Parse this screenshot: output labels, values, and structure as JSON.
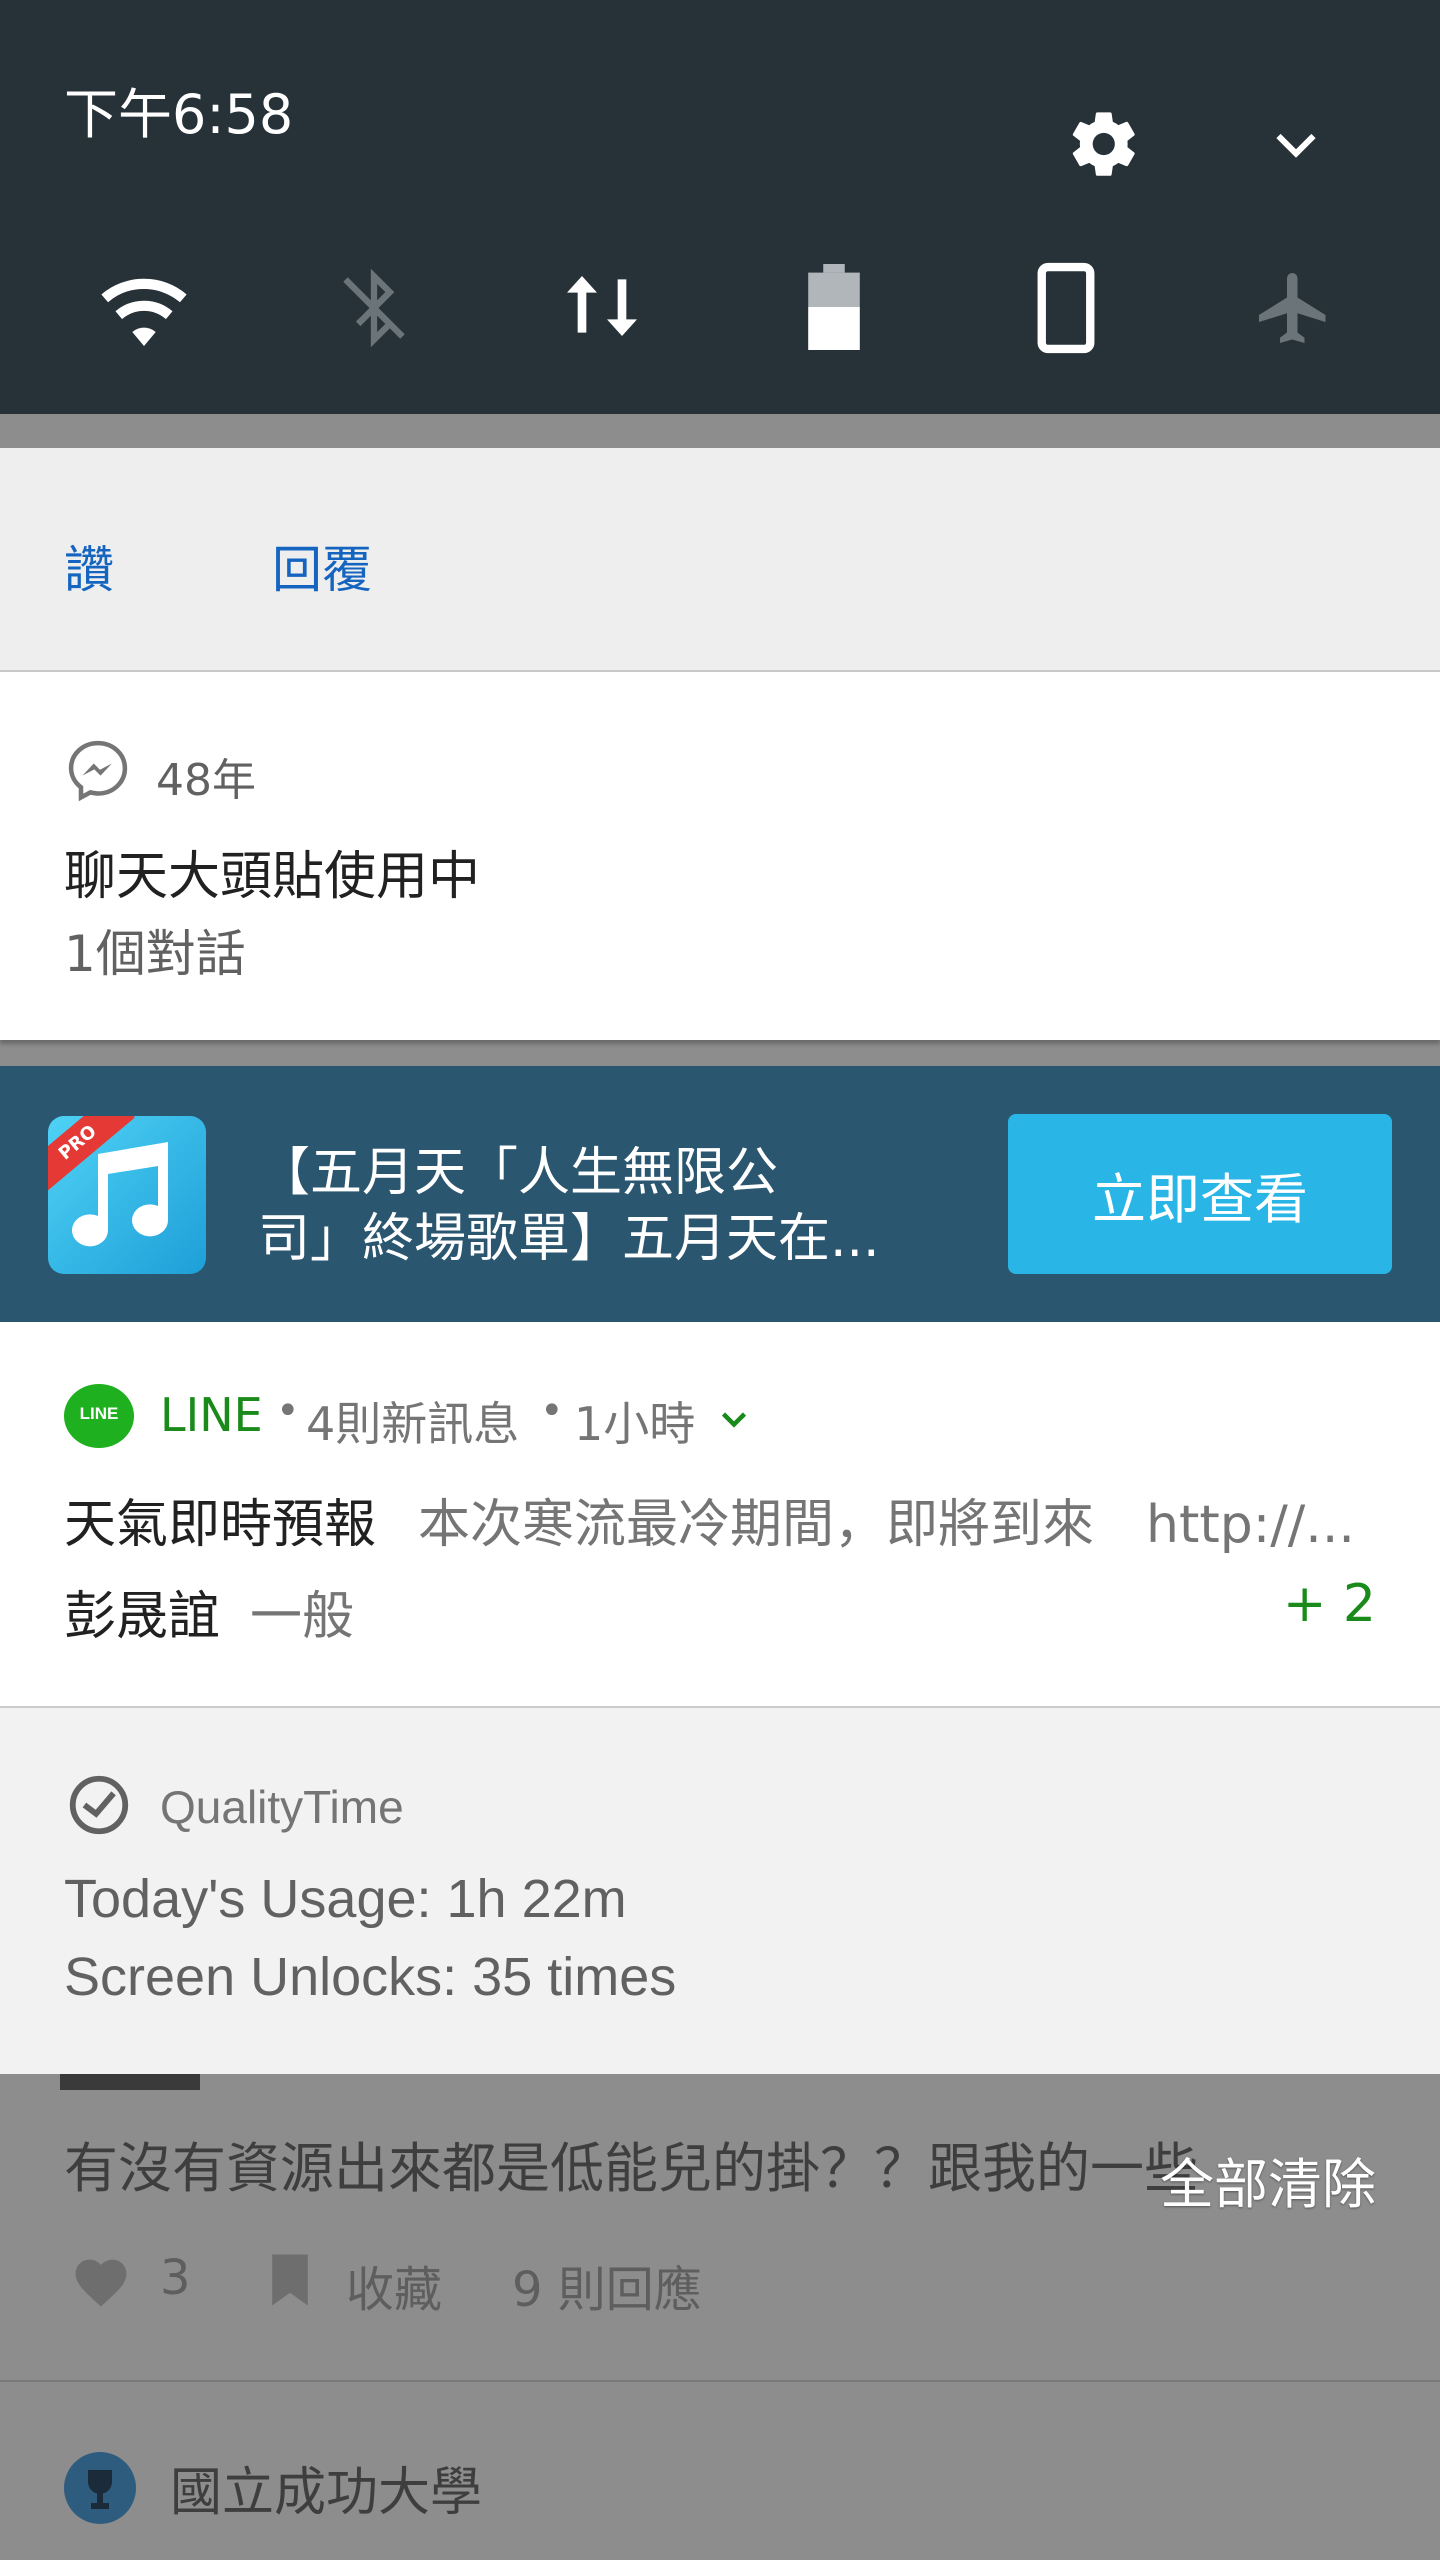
{
  "status": {
    "time": "下午6:58"
  },
  "actions_card": {
    "like_label": "讚",
    "reply_label": "回覆"
  },
  "messenger": {
    "app_name": "48年",
    "title": "聊天大頭貼使用中",
    "subtitle": "1個對話"
  },
  "ad": {
    "badge": "PRO",
    "line1": "【五月天「人生無限公",
    "line2": "司」終場歌單】五月天在...",
    "cta": "立即查看"
  },
  "line": {
    "app_name": "LINE",
    "sep": "•",
    "count": "4則新訊息",
    "age": "1小時",
    "row1_sender": "天氣即時預報",
    "row1_text": "本次寒流最冷期間，即將到來　http://...",
    "row2_sender": "彭晟誼",
    "row2_text": "一般",
    "more": "+ 2"
  },
  "qualitytime": {
    "app_name": "QualityTime",
    "usage": "Today's Usage: 1h 22m",
    "unlocks": "Screen Unlocks: 35 times"
  },
  "background_app": {
    "post_text": "有沒有資源出來都是低能兒的掛？？跟我的一些",
    "likes": "3",
    "bookmark": "收藏",
    "replies": "9 則回應",
    "next_title": "國立成功大學"
  },
  "clear_all": "全部清除",
  "colors": {
    "header": "#263238",
    "link_blue": "#1565c0",
    "line_green": "#1a8a1a",
    "ad_bg": "#2b5670",
    "cta_bg": "#29b6e6"
  }
}
